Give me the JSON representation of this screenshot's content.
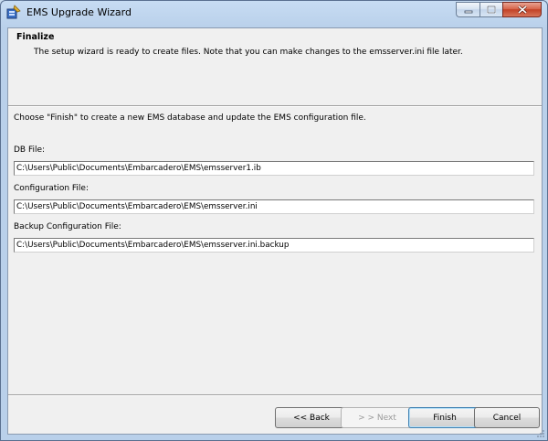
{
  "window": {
    "title": "EMS Upgrade Wizard",
    "icon": "wizard-app-icon",
    "controls": {
      "minimize_icon": "minimize-icon",
      "maximize_icon": "maximize-icon",
      "close_icon": "close-icon"
    }
  },
  "header": {
    "title": "Finalize",
    "subtitle": "The setup wizard is ready to create files.  Note that you can make changes to the emsserver.ini file later."
  },
  "main": {
    "instructions": "Choose \"Finish\" to create a new EMS database and update the EMS configuration file.",
    "db_file": {
      "label": "DB File:",
      "value": "C:\\Users\\Public\\Documents\\Embarcadero\\EMS\\emsserver1.ib"
    },
    "config_file": {
      "label": "Configuration File:",
      "value": "C:\\Users\\Public\\Documents\\Embarcadero\\EMS\\emsserver.ini"
    },
    "backup_file": {
      "label": "Backup Configuration File:",
      "value": "C:\\Users\\Public\\Documents\\Embarcadero\\EMS\\emsserver.ini.backup"
    }
  },
  "buttons": {
    "back": "<< Back",
    "next": "> > Next",
    "finish": "Finish",
    "cancel": "Cancel"
  },
  "colors": {
    "accent": "#3c7fb1",
    "close": "#c24126"
  }
}
